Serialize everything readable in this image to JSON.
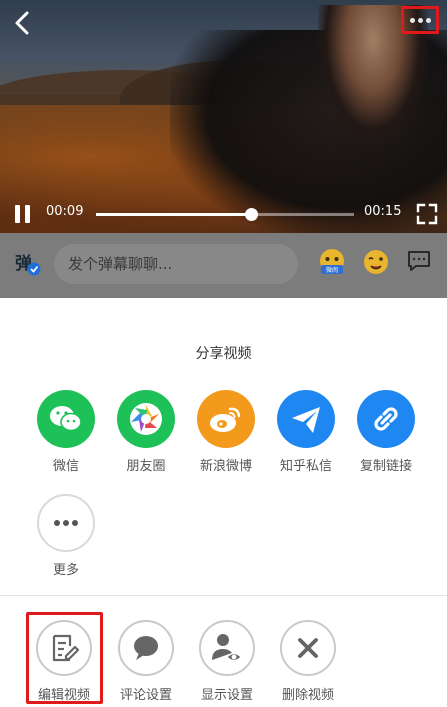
{
  "video": {
    "current_time": "00:09",
    "total_time": "00:15",
    "progress": 0.6
  },
  "icons": {
    "back": "back-chevron-icon",
    "more": "more-dots-icon",
    "pause": "pause-icon",
    "fullscreen": "fullscreen-icon"
  },
  "danmaku": {
    "toggle_icon": "danmaku-toggle-icon",
    "toggle_glyph": "弹",
    "placeholder": "发个弹幕聊聊...",
    "emoji_icon_label": "微闹"
  },
  "share": {
    "title": "分享视频",
    "items": [
      {
        "label": "微信",
        "icon": "wechat-icon",
        "color": "#1dc158"
      },
      {
        "label": "朋友圈",
        "icon": "moments-icon",
        "color": "#1dc158"
      },
      {
        "label": "新浪微博",
        "icon": "weibo-icon",
        "color": "#f39a1c"
      },
      {
        "label": "知乎私信",
        "icon": "zhihu-message-icon",
        "color": "#1e87f2"
      },
      {
        "label": "复制链接",
        "icon": "link-icon",
        "color": "#1e87f2"
      }
    ],
    "more_label": "更多"
  },
  "actions": [
    {
      "label": "编辑视频",
      "icon": "edit-icon"
    },
    {
      "label": "评论设置",
      "icon": "comment-icon"
    },
    {
      "label": "显示设置",
      "icon": "visibility-icon"
    },
    {
      "label": "删除视频",
      "icon": "delete-icon"
    }
  ],
  "colors": {
    "highlight": "#e0191a",
    "wechat_green": "#1dc158",
    "weibo_orange": "#f39a1c",
    "zhihu_blue": "#1e87f2"
  }
}
